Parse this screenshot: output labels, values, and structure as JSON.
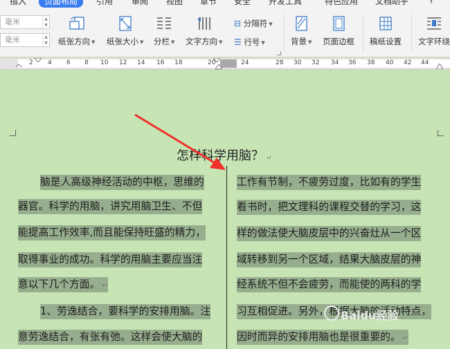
{
  "tabs": [
    "插入",
    "页面布局",
    "引用",
    "审阅",
    "视图",
    "章节",
    "安全",
    "开发工具",
    "特色应用",
    "文档助手"
  ],
  "active_tab": "页面布局",
  "margin_unit_top": "毫米",
  "margin_unit_bottom": "毫米",
  "ribbon": {
    "paper_orientation": "纸张方向",
    "paper_size": "纸张大小",
    "columns": "分栏",
    "text_direction": "文字方向",
    "separator": "分隔符",
    "line_number": "行号",
    "background": "背景",
    "page_border": "页面边框",
    "manuscript": "稿纸设置",
    "text_wrap": "文字环绕"
  },
  "ruler_numbers": [
    "2",
    "4",
    "6",
    "8",
    "10",
    "12",
    "14",
    "16",
    "18",
    "20",
    "24",
    "28",
    "30",
    "32",
    "34",
    "36",
    "38",
    "40",
    "42",
    "44"
  ],
  "document": {
    "title": "怎样科学用脑？",
    "para_mark": "↵",
    "left_column": [
      "脑是人高级神经活动的中枢，思维的",
      "器官。科学的用脑，讲究用脑卫生、不但",
      "能提高工作效率,而且能保持旺盛的精力，",
      "取得事业的成功。科学的用脑主要应当注",
      "意以下几个方面。",
      "1、劳逸结合，要科学的安排用脑。注",
      "意劳逸结合，有张有弛。这样会使大脑的"
    ],
    "right_column": [
      "工作有节制，不疲劳过度，比如有的学生",
      "看书时，把文理科的课程交替的学习，这",
      "样的做法使大脑皮层中的兴奋灶从一个区",
      "域转移到另一个区域，结果大脑皮层的神",
      "经系统不但不会疲劳，而能使的两科的学",
      "习互相促进。另外，根据大脑的活动特点，",
      "因时而异的安排用脑也是很重要的。"
    ]
  },
  "watermark": "Baidu经验",
  "colors": {
    "page_bg": "#c7e4b5",
    "highlight": "#97ae8e",
    "arrow": "#f0302a",
    "active_tab": "#3a7df0"
  }
}
